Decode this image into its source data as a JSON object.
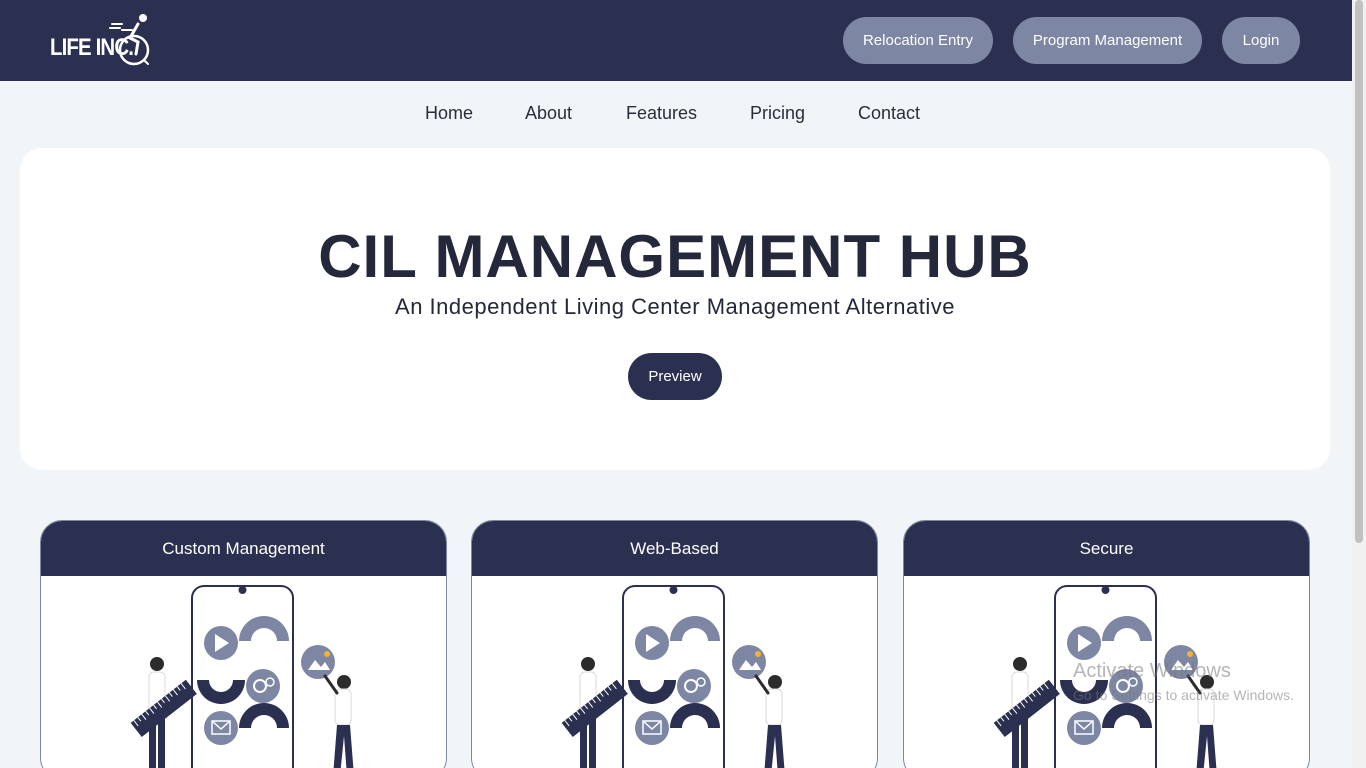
{
  "header": {
    "logo_text": "LIFE INC.",
    "buttons": [
      "Relocation Entry",
      "Program Management",
      "Login"
    ]
  },
  "nav": {
    "items": [
      "Home",
      "About",
      "Features",
      "Pricing",
      "Contact"
    ]
  },
  "hero": {
    "title": "CIL MANAGEMENT HUB",
    "subtitle": "An Independent Living Center Management Alternative",
    "cta_label": "Preview"
  },
  "features": {
    "cards": [
      {
        "title": "Custom Management"
      },
      {
        "title": "Web-Based"
      },
      {
        "title": "Secure"
      }
    ]
  },
  "watermark": {
    "line1": "Activate Windows",
    "line2": "Go to Settings to activate Windows."
  },
  "colors": {
    "navy": "#2c3050",
    "slate": "#7d86a3",
    "page_bg": "#f1f5f7"
  }
}
